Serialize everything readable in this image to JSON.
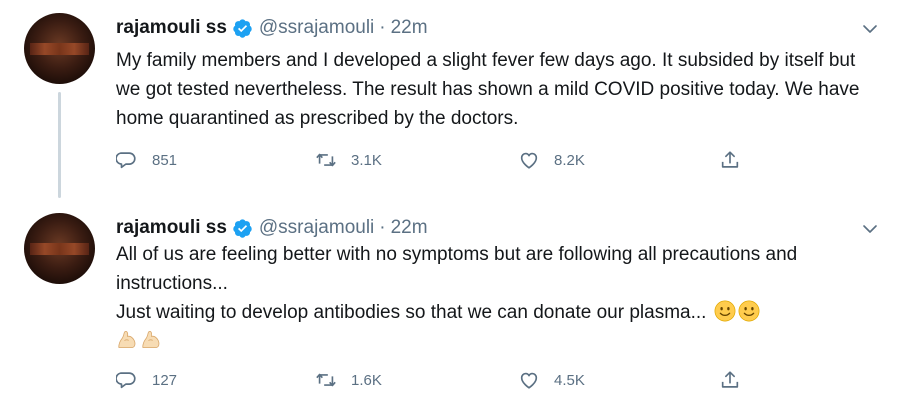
{
  "tweets": [
    {
      "name": "rajamouli ss",
      "handle": "@ssrajamouli",
      "separator": "·",
      "time": "22m",
      "text": "My family members and I developed a slight fever few days ago. It subsided by itself but we got tested nevertheless. The result has shown a mild COVID positive today. We have home quarantined as prescribed by the doctors.",
      "replies": "851",
      "retweets": "3.1K",
      "likes": "8.2K"
    },
    {
      "name": "rajamouli ss",
      "handle": "@ssrajamouli",
      "separator": "·",
      "time": "22m",
      "text_line1": "All of us are feeling better with no symptoms but are following all precautions and instructions...",
      "text_line2": "Just waiting to develop antibodies so that we can donate our plasma...",
      "emojis": [
        "slightly-smiling-face",
        "slightly-smiling-face",
        "flexed-biceps",
        "flexed-biceps"
      ],
      "replies": "127",
      "retweets": "1.6K",
      "likes": "4.5K"
    }
  ],
  "colors": {
    "text": "#14171a",
    "secondary": "#5b7083",
    "verified_blue": "#1da1f2",
    "thread_line": "#ccd6dd"
  },
  "icons": {
    "reply": "reply-bubble-icon",
    "retweet": "retweet-icon",
    "like": "heart-icon",
    "share": "share-icon",
    "more": "chevron-down-icon",
    "verified": "verified-badge-icon"
  }
}
